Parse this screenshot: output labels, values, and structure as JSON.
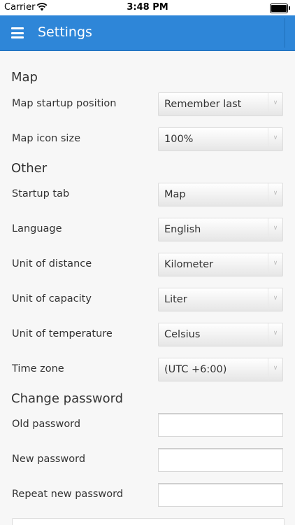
{
  "status_bar": {
    "carrier": "Carrier",
    "time": "3:48 PM"
  },
  "app_bar": {
    "title": "Settings"
  },
  "sections": {
    "map": {
      "title": "Map",
      "startup_position": {
        "label": "Map startup position",
        "value": "Remember last"
      },
      "icon_size": {
        "label": "Map icon size",
        "value": "100%"
      }
    },
    "other": {
      "title": "Other",
      "startup_tab": {
        "label": "Startup tab",
        "value": "Map"
      },
      "language": {
        "label": "Language",
        "value": "English"
      },
      "distance": {
        "label": "Unit of distance",
        "value": "Kilometer"
      },
      "capacity": {
        "label": "Unit of capacity",
        "value": "Liter"
      },
      "temperature": {
        "label": "Unit of temperature",
        "value": "Celsius"
      },
      "time_zone": {
        "label": "Time zone",
        "value": "(UTC +6:00)"
      }
    },
    "password": {
      "title": "Change password",
      "old": {
        "label": "Old password",
        "value": ""
      },
      "new": {
        "label": "New password",
        "value": ""
      },
      "repeat": {
        "label": "Repeat new password",
        "value": ""
      }
    }
  },
  "colors": {
    "app_bar": "#2e86d8",
    "background": "#f7f7f7"
  },
  "icons": {
    "menu": "hamburger-menu-icon",
    "dropdown": "chevron-down-icon",
    "wifi": "wifi-icon",
    "battery": "battery-icon"
  }
}
